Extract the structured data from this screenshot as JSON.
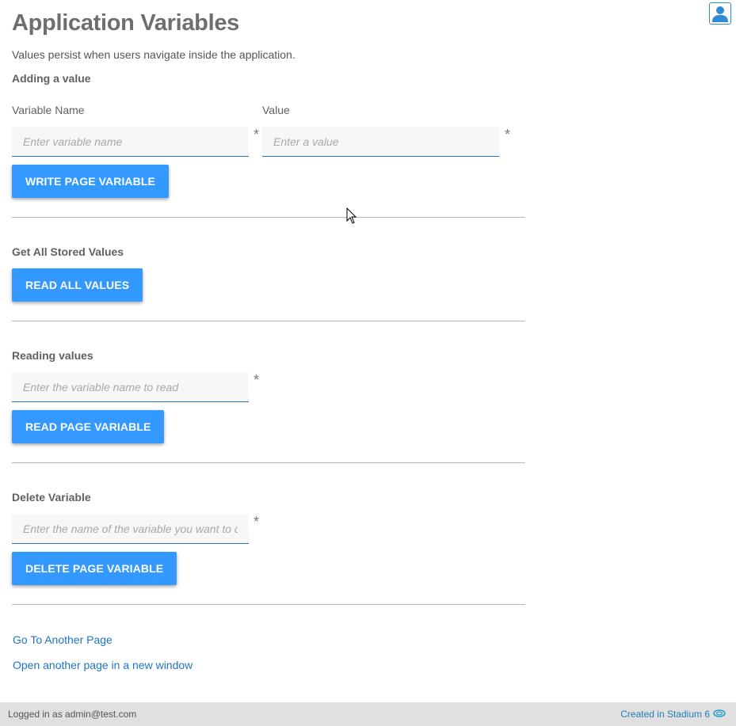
{
  "header": {
    "title": "Application Variables",
    "subtitle": "Values persist when users navigate inside the application.",
    "user_icon": "user-icon"
  },
  "adding": {
    "heading": "Adding a value",
    "name_label": "Variable Name",
    "name_placeholder": "Enter variable name",
    "value_label": "Value",
    "value_placeholder": "Enter a value",
    "required_mark": "*",
    "button": "WRITE PAGE VARIABLE"
  },
  "get_all": {
    "heading": "Get All Stored Values",
    "button": "READ ALL VALUES"
  },
  "reading": {
    "heading": "Reading values",
    "placeholder": "Enter the variable name to read",
    "required_mark": "*",
    "button": "READ PAGE VARIABLE"
  },
  "delete": {
    "heading": "Delete Variable",
    "placeholder": "Enter the name of the variable you want to delete",
    "required_mark": "*",
    "button": "DELETE PAGE VARIABLE"
  },
  "links": {
    "go_to_page": "Go To Another Page",
    "open_new_window": "Open another page in a new window"
  },
  "footer": {
    "logged_in": "Logged in as admin@test.com",
    "created_in": "Created in Stadium 6",
    "logo_icon": "stadium-logo-icon"
  },
  "colors": {
    "primary_button": "#3399ff",
    "link": "#1f74c4",
    "footer_bg": "#e0e0e0"
  }
}
